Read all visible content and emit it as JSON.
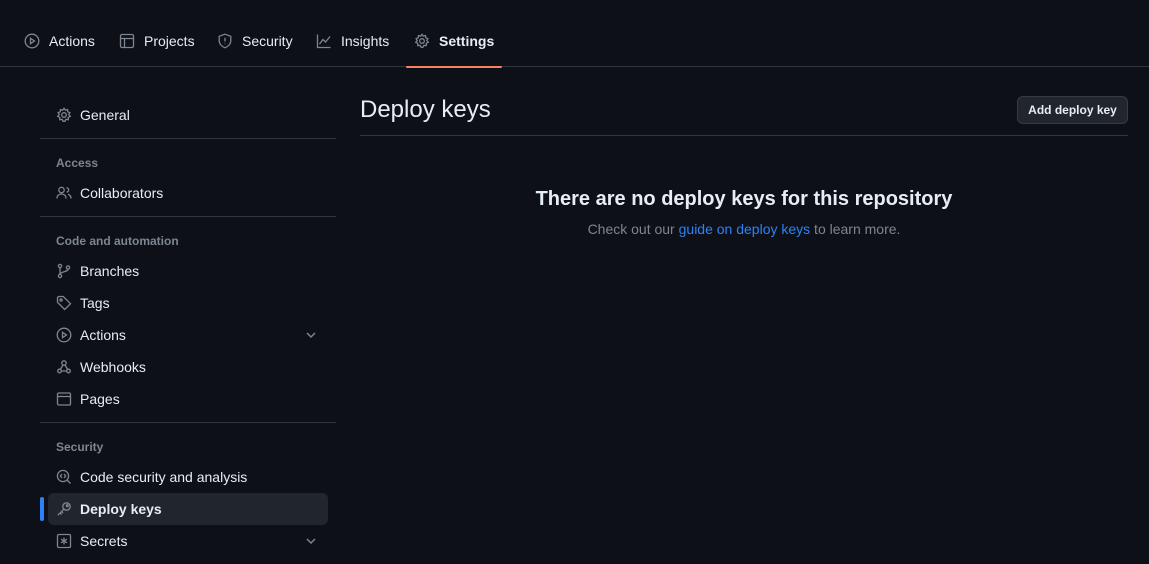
{
  "topnav": {
    "tabs": [
      {
        "label": "Actions",
        "icon": "play-icon"
      },
      {
        "label": "Projects",
        "icon": "table-icon"
      },
      {
        "label": "Security",
        "icon": "shield-icon"
      },
      {
        "label": "Insights",
        "icon": "graph-icon"
      },
      {
        "label": "Settings",
        "icon": "gear-icon",
        "active": true
      }
    ]
  },
  "sidebar": {
    "general": "General",
    "access_heading": "Access",
    "collaborators": "Collaborators",
    "code_heading": "Code and automation",
    "branches": "Branches",
    "tags": "Tags",
    "actions": "Actions",
    "webhooks": "Webhooks",
    "pages": "Pages",
    "security_heading": "Security",
    "code_security": "Code security and analysis",
    "deploy_keys": "Deploy keys",
    "secrets": "Secrets"
  },
  "main": {
    "title": "Deploy keys",
    "add_button": "Add deploy key",
    "blank_title": "There are no deploy keys for this repository",
    "blank_prefix": "Check out our ",
    "blank_link": "guide on deploy keys",
    "blank_suffix": " to learn more."
  },
  "colors": {
    "background": "#0d1117",
    "accent": "#2f81f7",
    "tab_underline": "#f78166"
  }
}
